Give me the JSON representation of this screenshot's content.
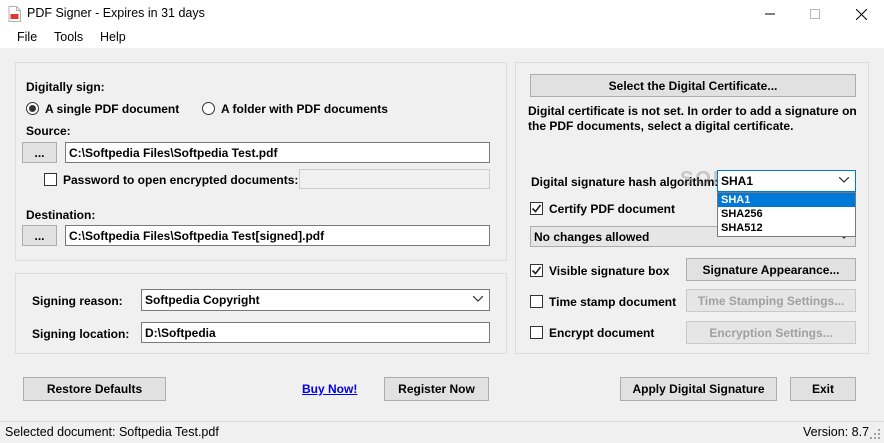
{
  "window": {
    "title": "PDF Signer - Expires in 31 days"
  },
  "menu": [
    "File",
    "Tools",
    "Help"
  ],
  "left": {
    "digitally_sign_label": "Digitally sign:",
    "radio_single": "A single PDF document",
    "radio_folder": "A folder with PDF documents",
    "source_label": "Source:",
    "browse_label": "...",
    "source_value": "C:\\Softpedia Files\\Softpedia Test.pdf",
    "password_label": "Password to open encrypted documents:",
    "password_value": "",
    "destination_label": "Destination:",
    "destination_value": "C:\\Softpedia Files\\Softpedia Test[signed].pdf",
    "signing_reason_label": "Signing reason:",
    "signing_reason_value": "Softpedia Copyright",
    "signing_location_label": "Signing location:",
    "signing_location_value": "D:\\Softpedia"
  },
  "right": {
    "select_cert_button": "Select the Digital Certificate...",
    "cert_info": "Digital certificate is not set. In order to add a signature on the PDF documents, select a digital certificate.",
    "hash_label": "Digital signature hash algorithm:",
    "hash_value": "SHA1",
    "hash_options": [
      "SHA1",
      "SHA256",
      "SHA512"
    ],
    "certify_label": "Certify PDF document",
    "certify_checked": true,
    "changes_value": "No changes allowed",
    "visible_sig_label": "Visible signature box",
    "visible_sig_checked": true,
    "sig_appearance_button": "Signature Appearance...",
    "timestamp_label": "Time stamp document",
    "timestamp_checked": false,
    "timestamp_button": "Time Stamping Settings...",
    "encrypt_label": "Encrypt document",
    "encrypt_checked": false,
    "encryption_button": "Encryption Settings..."
  },
  "bottom": {
    "restore_button": "Restore Defaults",
    "buy_link": "Buy Now!",
    "register_button": "Register Now",
    "apply_button": "Apply Digital Signature",
    "exit_button": "Exit"
  },
  "status": {
    "selected_doc": "Selected document: Softpedia Test.pdf",
    "version": "Version: 8.7"
  },
  "colors": {
    "selection": "#0078d7",
    "link": "#0000ee",
    "pdf_icon": "#e03a2f"
  }
}
